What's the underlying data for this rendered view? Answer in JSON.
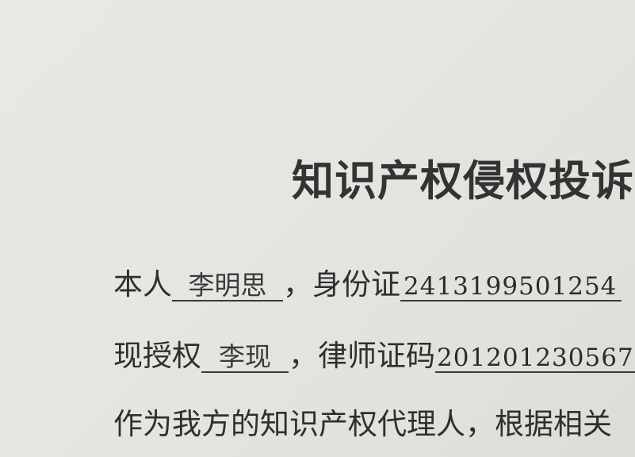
{
  "document": {
    "title": "知识产权侵权投诉",
    "line1": {
      "prefix": "本人",
      "name": "李明思",
      "sep": "，身份证",
      "id_number": "2413199501254"
    },
    "line2": {
      "prefix": "现授权",
      "name": "李现",
      "sep": "，律师证码",
      "license_number": "201201230567"
    },
    "line3": {
      "text": "作为我方的知识产权代理人，根据相关"
    }
  }
}
